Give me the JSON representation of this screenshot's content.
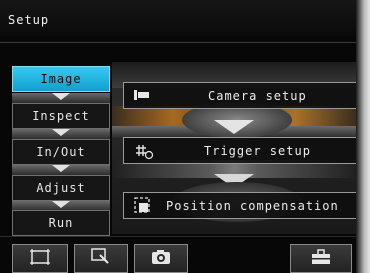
{
  "window": {
    "title": "Setup"
  },
  "menu": {
    "items": [
      {
        "label": "Image",
        "active": true
      },
      {
        "label": "Inspect",
        "active": false
      },
      {
        "label": "In/Out",
        "active": false
      },
      {
        "label": "Adjust",
        "active": false
      },
      {
        "label": "Run",
        "active": false
      }
    ]
  },
  "actions": {
    "camera_setup": "Camera setup",
    "trigger_setup": "Trigger setup",
    "position_compensation": "Position compensation"
  },
  "toolbar": {
    "icons": [
      "display-frame-icon",
      "zoom-area-icon",
      "camera-icon",
      "toolbox-icon"
    ]
  },
  "colors": {
    "accent": "#1eb3e3",
    "background": "#070707",
    "text": "#ececec"
  }
}
